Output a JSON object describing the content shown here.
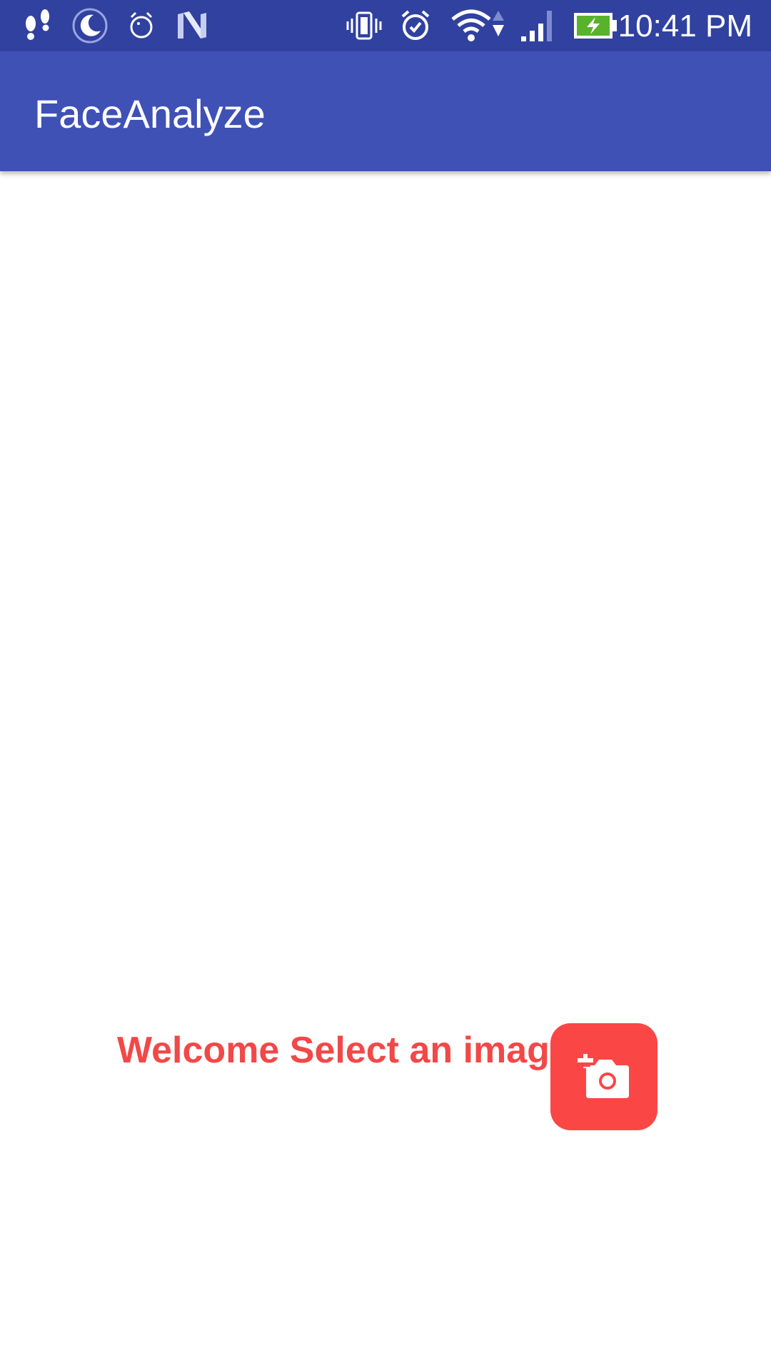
{
  "status_bar": {
    "time": "10:41 PM",
    "icons": [
      "steps-icon",
      "moon-icon",
      "alarm-small-icon",
      "n-icon",
      "vibrate-icon",
      "alarm-icon",
      "wifi-icon",
      "signal-icon",
      "battery-charging-icon"
    ],
    "background": "#3141a0"
  },
  "app_bar": {
    "title": "FaceAnalyze",
    "background": "#3f51b5"
  },
  "main": {
    "welcome_text": "Welcome Select an image",
    "accent": "#f24848",
    "fab": {
      "icon": "add-a-photo-icon",
      "color": "#fb4646"
    }
  }
}
